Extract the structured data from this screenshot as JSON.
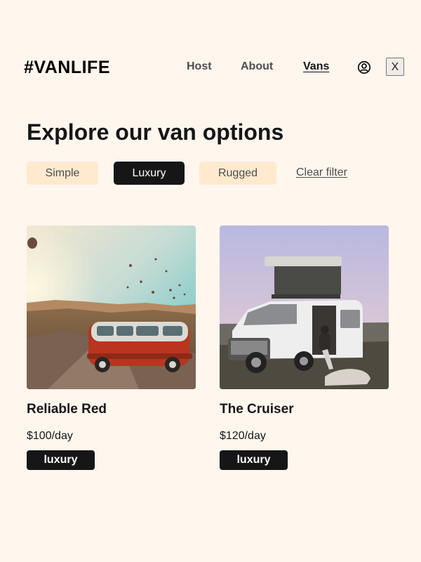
{
  "header": {
    "logo": "#VANLIFE",
    "nav": [
      {
        "label": "Host"
      },
      {
        "label": "About"
      },
      {
        "label": "Vans",
        "active": true
      }
    ],
    "profile_icon": "user-circle-icon",
    "close_label": "X"
  },
  "main": {
    "title": "Explore our van options",
    "filters": [
      {
        "label": "Simple",
        "selected": false
      },
      {
        "label": "Luxury",
        "selected": true
      },
      {
        "label": "Rugged",
        "selected": false
      }
    ],
    "clear_filter": "Clear filter",
    "vans": [
      {
        "name": "Reliable Red",
        "price": "$100/day",
        "type": "luxury",
        "image": "red-vintage-van-with-hot-air-balloons"
      },
      {
        "name": "The Cruiser",
        "price": "$120/day",
        "type": "luxury",
        "image": "white-camper-van-with-rooftop-tent"
      }
    ]
  },
  "colors": {
    "background": "#fff6ee",
    "filter_bg": "#ffead0",
    "dark": "#161616",
    "muted_text": "#4d4d4d"
  }
}
